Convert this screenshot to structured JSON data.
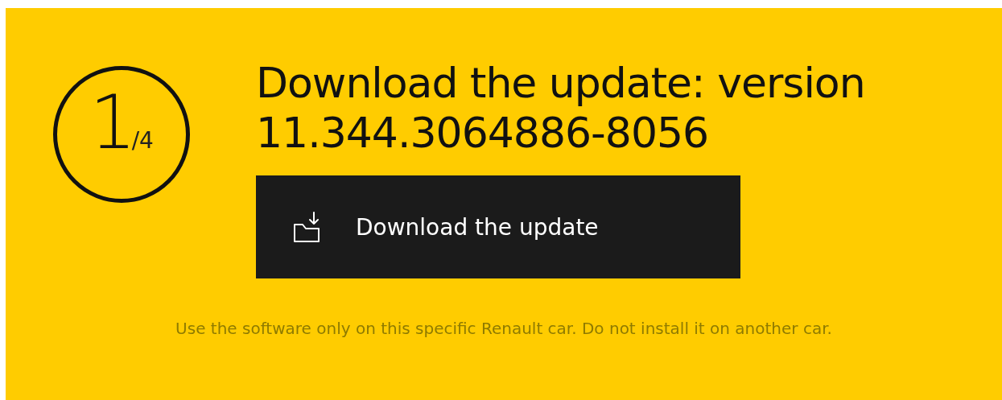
{
  "step": {
    "current": "1",
    "total": "/4"
  },
  "title": "Download the update: version 11.344.3064886-8056",
  "download_button": {
    "label": "Download the update"
  },
  "disclaimer": "Use the software only on this specific Renault car. Do not install it on another car."
}
